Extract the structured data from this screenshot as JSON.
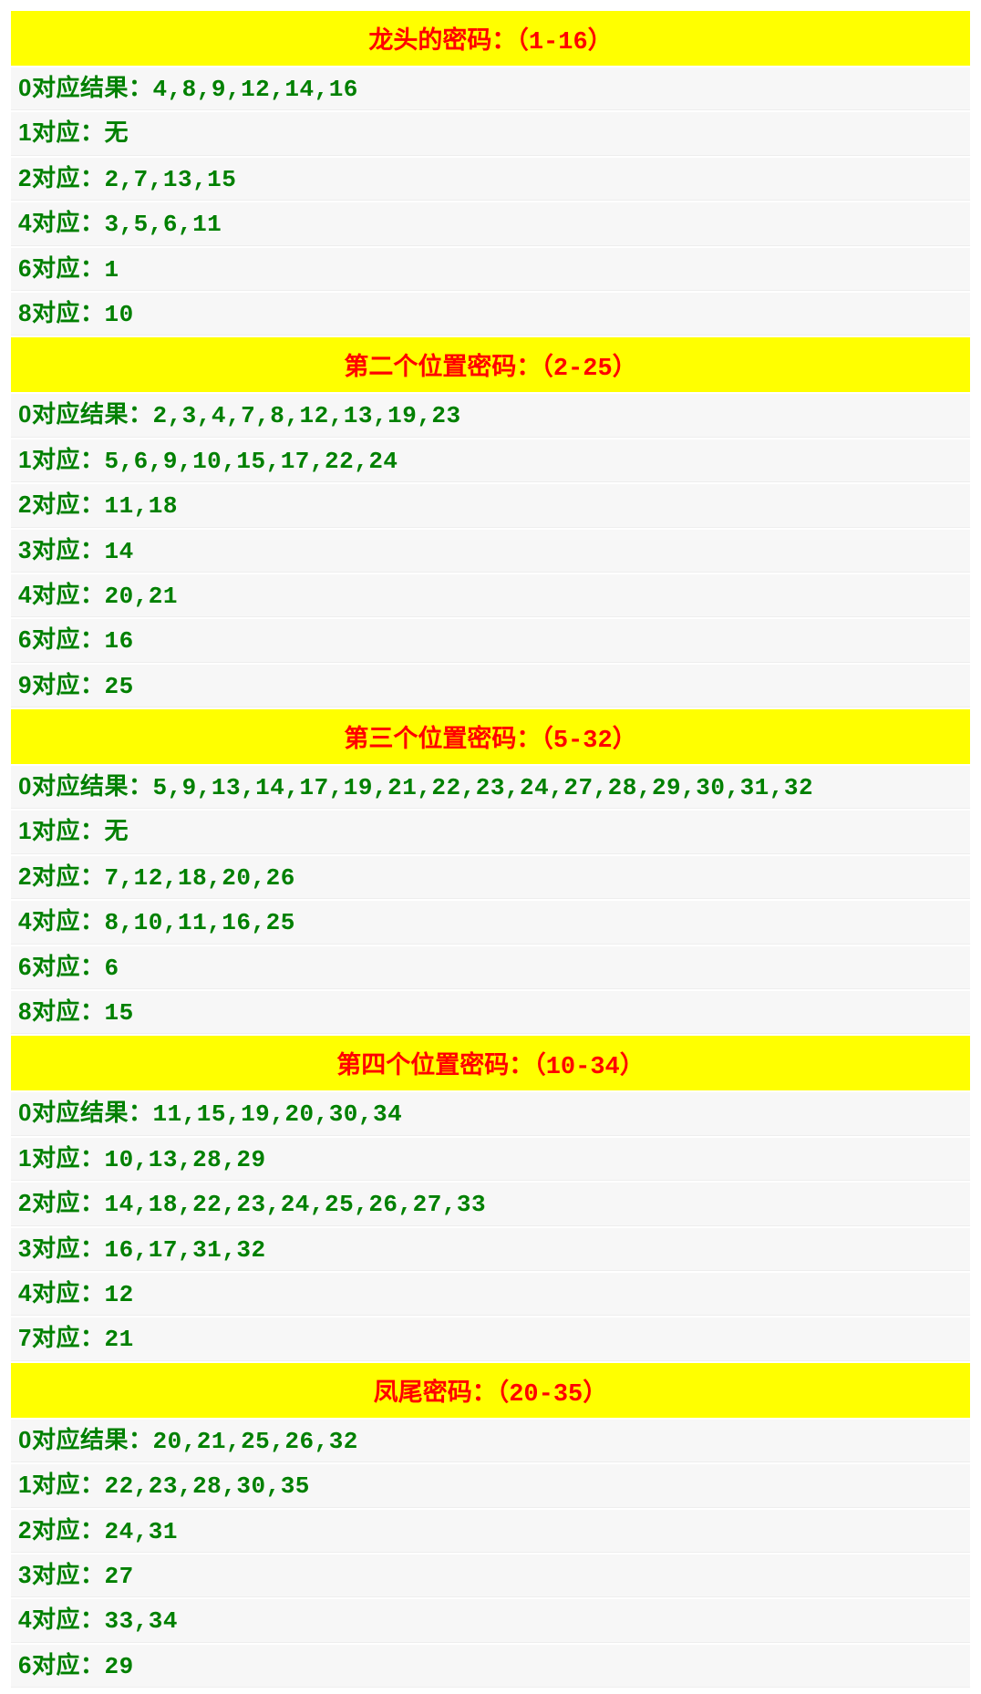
{
  "sections": [
    {
      "title": "龙头的密码：（1-16）",
      "rows": [
        {
          "label": "0对应结果：",
          "values": "4,8,9,12,14,16"
        },
        {
          "label": "1对应：",
          "values": "无"
        },
        {
          "label": "2对应：",
          "values": "2,7,13,15"
        },
        {
          "label": "4对应：",
          "values": "3,5,6,11"
        },
        {
          "label": "6对应：",
          "values": "1"
        },
        {
          "label": "8对应：",
          "values": "10"
        }
      ]
    },
    {
      "title": "第二个位置密码：（2-25）",
      "rows": [
        {
          "label": "0对应结果：",
          "values": "2,3,4,7,8,12,13,19,23"
        },
        {
          "label": "1对应：",
          "values": "5,6,9,10,15,17,22,24"
        },
        {
          "label": "2对应：",
          "values": "11,18"
        },
        {
          "label": "3对应：",
          "values": "14"
        },
        {
          "label": "4对应：",
          "values": "20,21"
        },
        {
          "label": "6对应：",
          "values": "16"
        },
        {
          "label": "9对应：",
          "values": "25"
        }
      ]
    },
    {
      "title": "第三个位置密码：（5-32）",
      "rows": [
        {
          "label": "0对应结果：",
          "values": "5,9,13,14,17,19,21,22,23,24,27,28,29,30,31,32"
        },
        {
          "label": "1对应：",
          "values": "无"
        },
        {
          "label": "2对应：",
          "values": "7,12,18,20,26"
        },
        {
          "label": "4对应：",
          "values": "8,10,11,16,25"
        },
        {
          "label": "6对应：",
          "values": "6"
        },
        {
          "label": "8对应：",
          "values": "15"
        }
      ]
    },
    {
      "title": "第四个位置密码：（10-34）",
      "rows": [
        {
          "label": "0对应结果：",
          "values": "11,15,19,20,30,34"
        },
        {
          "label": "1对应：",
          "values": "10,13,28,29"
        },
        {
          "label": "2对应：",
          "values": "14,18,22,23,24,25,26,27,33"
        },
        {
          "label": "3对应：",
          "values": "16,17,31,32"
        },
        {
          "label": "4对应：",
          "values": "12"
        },
        {
          "label": "7对应：",
          "values": "21"
        }
      ]
    },
    {
      "title": "凤尾密码：（20-35）",
      "rows": [
        {
          "label": "0对应结果：",
          "values": "20,21,25,26,32"
        },
        {
          "label": "1对应：",
          "values": "22,23,28,30,35"
        },
        {
          "label": "2对应：",
          "values": "24,31"
        },
        {
          "label": "3对应：",
          "values": "27"
        },
        {
          "label": "4对应：",
          "values": "33,34"
        },
        {
          "label": "6对应：",
          "values": "29"
        }
      ]
    }
  ]
}
